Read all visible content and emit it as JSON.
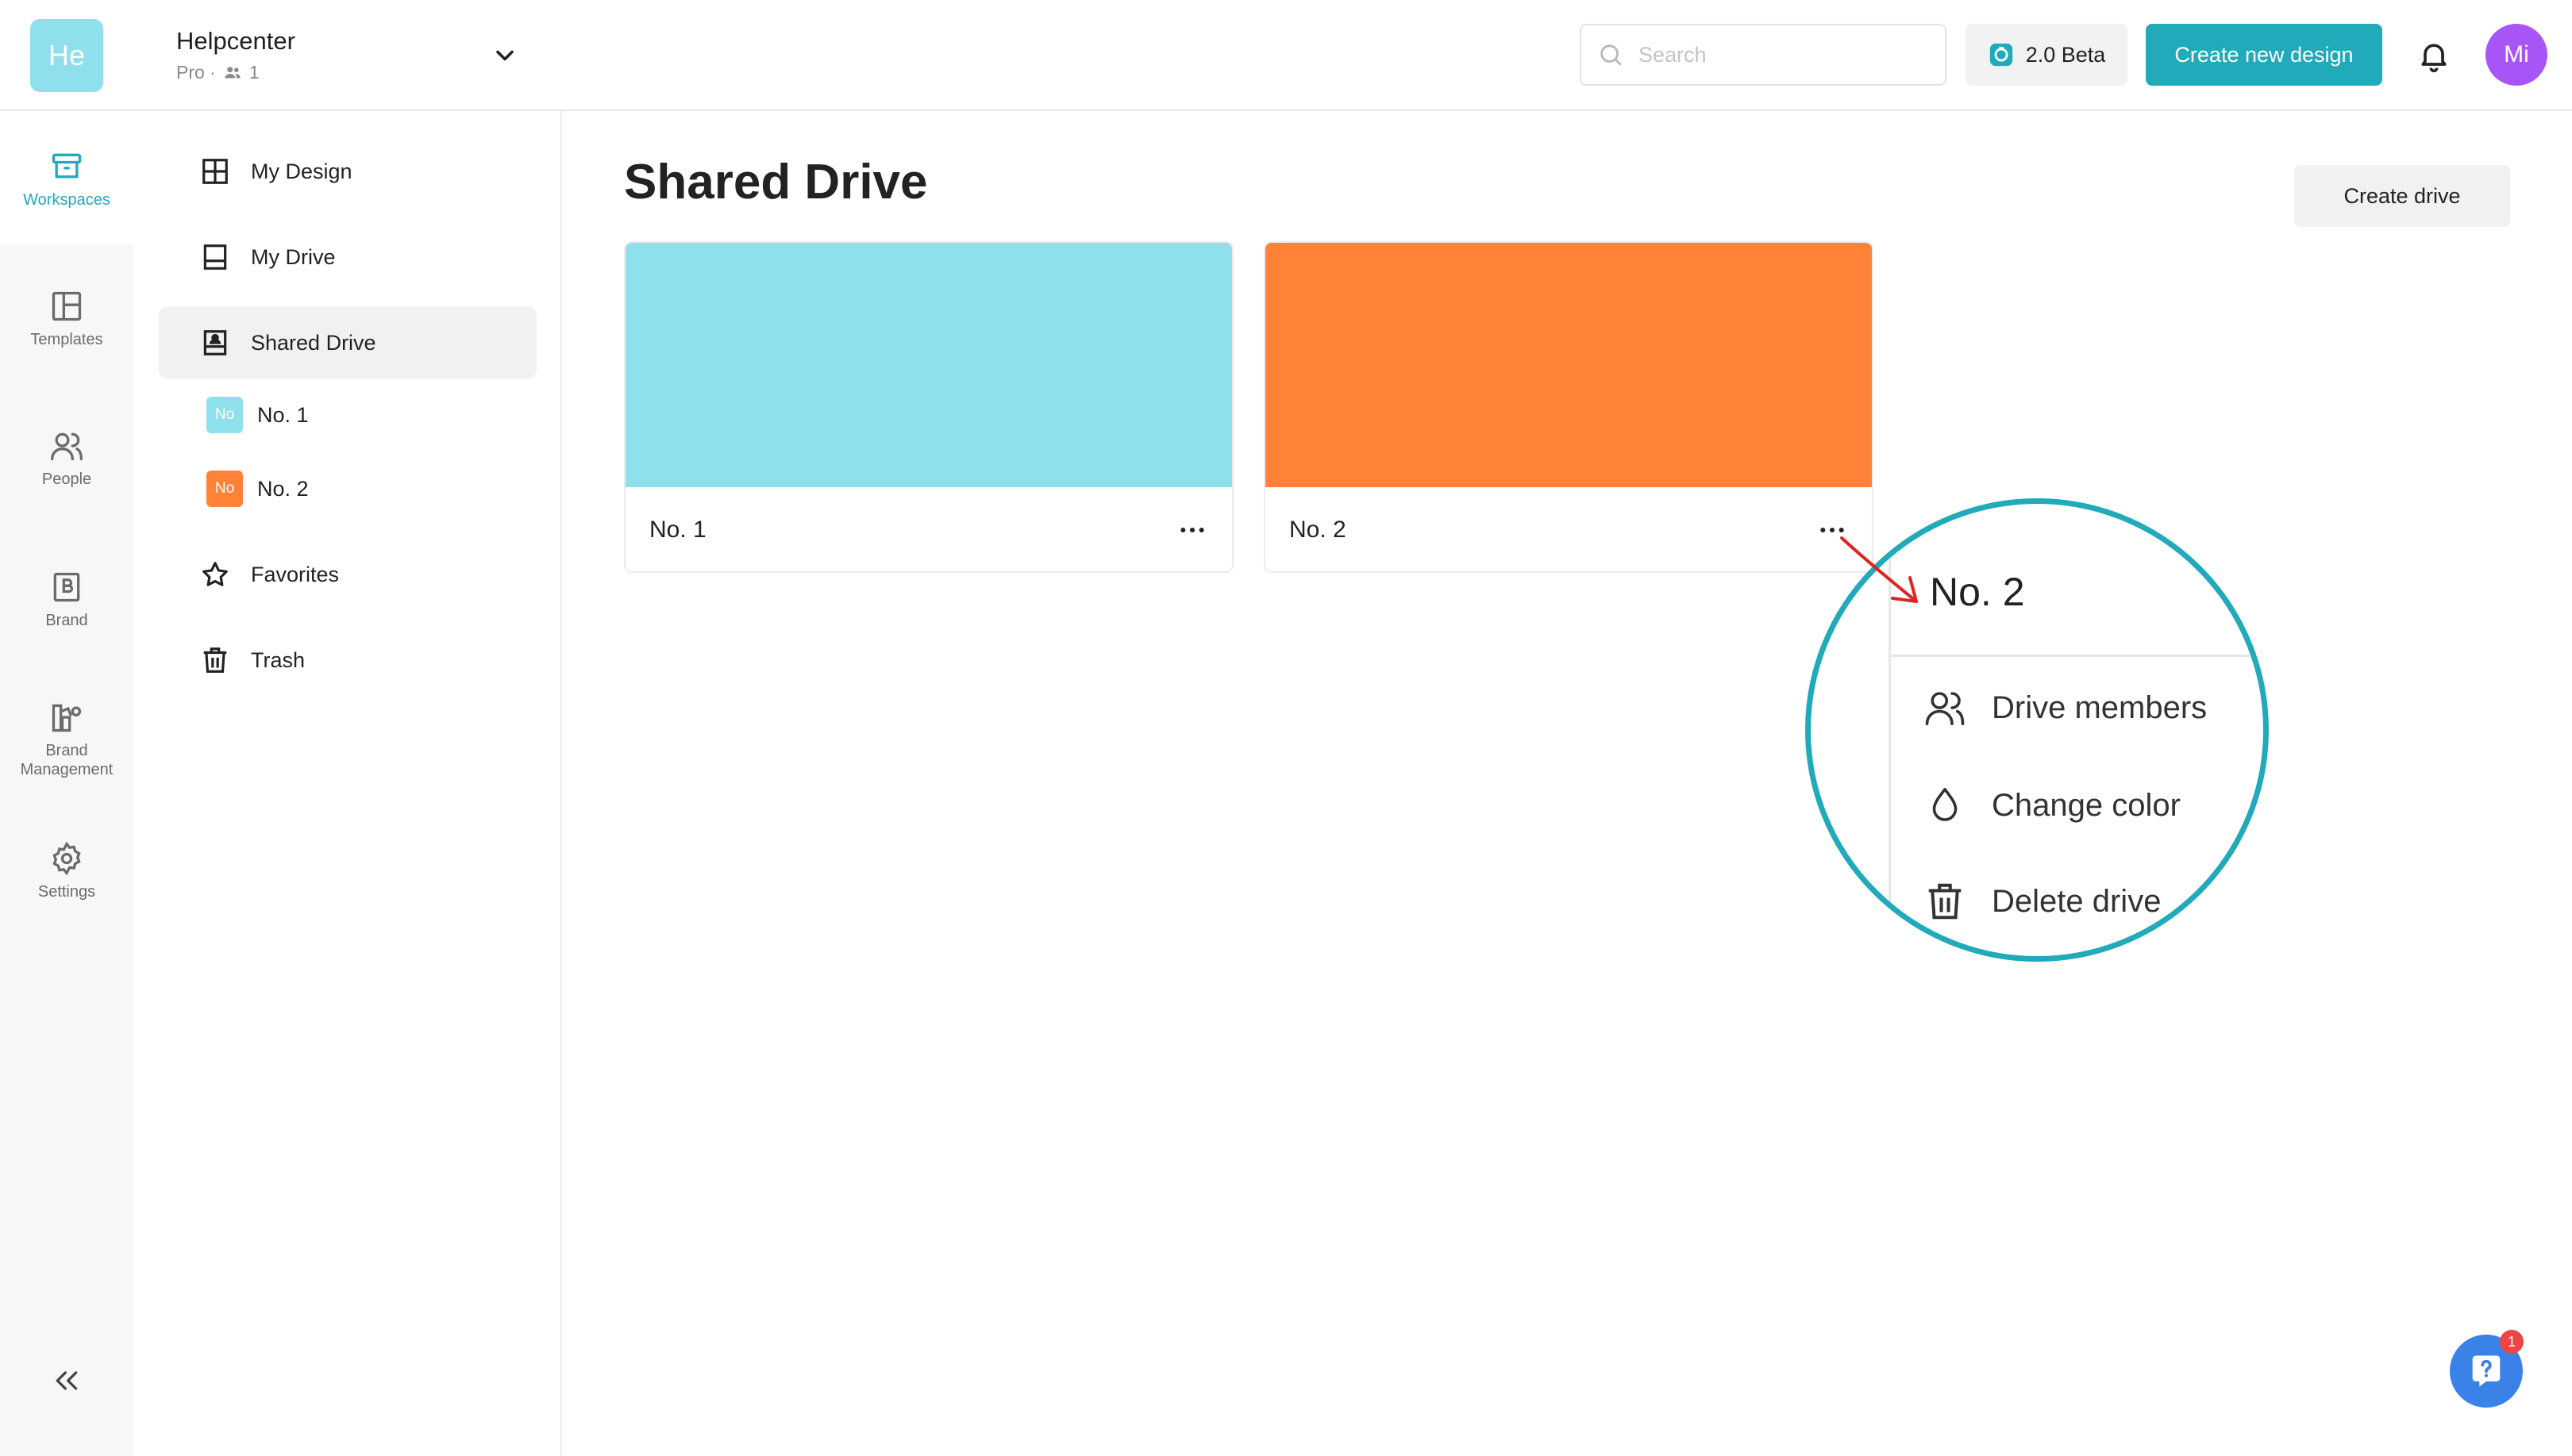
{
  "workspace": {
    "logo_text": "He",
    "logo_color": "#8ee0ec",
    "name": "Helpcenter",
    "plan": "Pro ·",
    "member_count": "1"
  },
  "header": {
    "search_placeholder": "Search",
    "beta_label": "2.0 Beta",
    "create_design_label": "Create new design",
    "avatar_initials": "Mi",
    "avatar_color": "#a855f7",
    "accent_color": "#21aab9"
  },
  "rail": {
    "items": [
      {
        "label": "Workspaces",
        "icon": "archive-icon",
        "active": true
      },
      {
        "label": "Templates",
        "icon": "layout-icon"
      },
      {
        "label": "People",
        "icon": "people-icon"
      },
      {
        "label": "Brand",
        "icon": "brand-icon"
      },
      {
        "label": "Brand Management",
        "icon": "brand-management-icon"
      },
      {
        "label": "Settings",
        "icon": "gear-icon"
      }
    ],
    "collapse_icon": "chevrons-left-icon"
  },
  "sidebar": {
    "items": [
      {
        "label": "My Design",
        "icon": "grid-icon"
      },
      {
        "label": "My Drive",
        "icon": "drive-icon"
      },
      {
        "label": "Shared Drive",
        "icon": "shared-drive-icon",
        "active": true
      },
      {
        "label": "Favorites",
        "icon": "star-icon"
      },
      {
        "label": "Trash",
        "icon": "trash-icon"
      }
    ],
    "sub_items": [
      {
        "chip": "No",
        "label": "No. 1",
        "color": "#8ee0ec"
      },
      {
        "chip": "No",
        "label": "No. 2",
        "color": "#ff8236"
      }
    ]
  },
  "main": {
    "title": "Shared Drive",
    "create_drive_label": "Create drive",
    "drives": [
      {
        "name": "No. 1",
        "color": "#8ee0ec"
      },
      {
        "name": "No. 2",
        "color": "#ff8236"
      }
    ]
  },
  "context_menu": {
    "title": "No. 2",
    "items": [
      {
        "label": "Drive members",
        "icon": "people-icon"
      },
      {
        "label": "Change color",
        "icon": "droplet-icon"
      },
      {
        "label": "Delete drive",
        "icon": "trash-icon"
      }
    ]
  },
  "help": {
    "badge": "1"
  }
}
